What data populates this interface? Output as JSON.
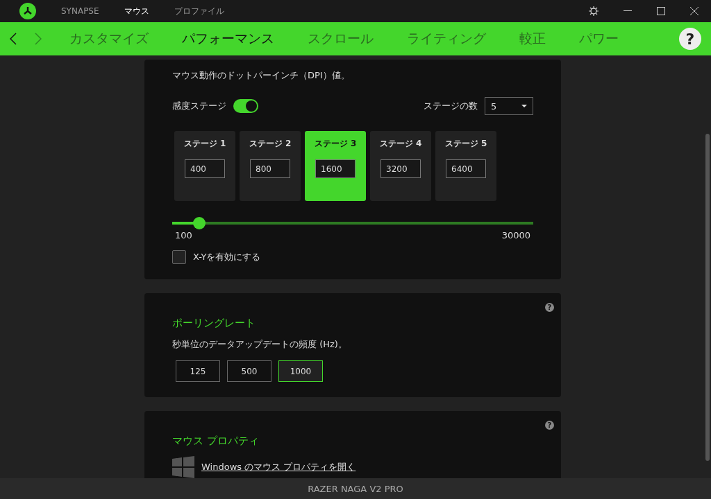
{
  "titlebar": {
    "tabs": [
      {
        "label": "SYNAPSE",
        "selected": false
      },
      {
        "label": "マウス",
        "selected": true
      },
      {
        "label": "プロファイル",
        "selected": false
      }
    ]
  },
  "nav": {
    "tabs": [
      {
        "label": "カスタマイズ",
        "selected": false
      },
      {
        "label": "パフォーマンス",
        "selected": true
      },
      {
        "label": "スクロール",
        "selected": false
      },
      {
        "label": "ライティング",
        "selected": false
      },
      {
        "label": "較正",
        "selected": false
      },
      {
        "label": "パワー",
        "selected": false
      }
    ],
    "help": "?"
  },
  "sensitivity": {
    "description": "マウス動作のドットパーインチ（DPI）値。",
    "stages_label": "感度ステージ",
    "stages_on": true,
    "count_label": "ステージの数",
    "count_value": "5",
    "stages": [
      {
        "label": "ステージ 1",
        "value": "400",
        "selected": false
      },
      {
        "label": "ステージ 2",
        "value": "800",
        "selected": false
      },
      {
        "label": "ステージ 3",
        "value": "1600",
        "selected": true
      },
      {
        "label": "ステージ 4",
        "value": "3200",
        "selected": false
      },
      {
        "label": "ステージ 5",
        "value": "6400",
        "selected": false
      }
    ],
    "slider": {
      "level": 0.06,
      "min": "100",
      "max": "30000"
    },
    "xy": {
      "label": "X-Yを有効にする",
      "checked": false
    }
  },
  "polling": {
    "title": "ポーリングレート",
    "description": "秒単位のデータアップデートの頻度 (Hz)。",
    "help": "?",
    "options": [
      {
        "label": "125",
        "selected": false
      },
      {
        "label": "500",
        "selected": false
      },
      {
        "label": "1000",
        "selected": true
      }
    ]
  },
  "mouse_props": {
    "title": "マウス プロパティ",
    "help": "?",
    "link": "Windows のマウス プロパティを開く"
  },
  "status_bar": {
    "device": "RAZER NAGA V2 PRO"
  }
}
